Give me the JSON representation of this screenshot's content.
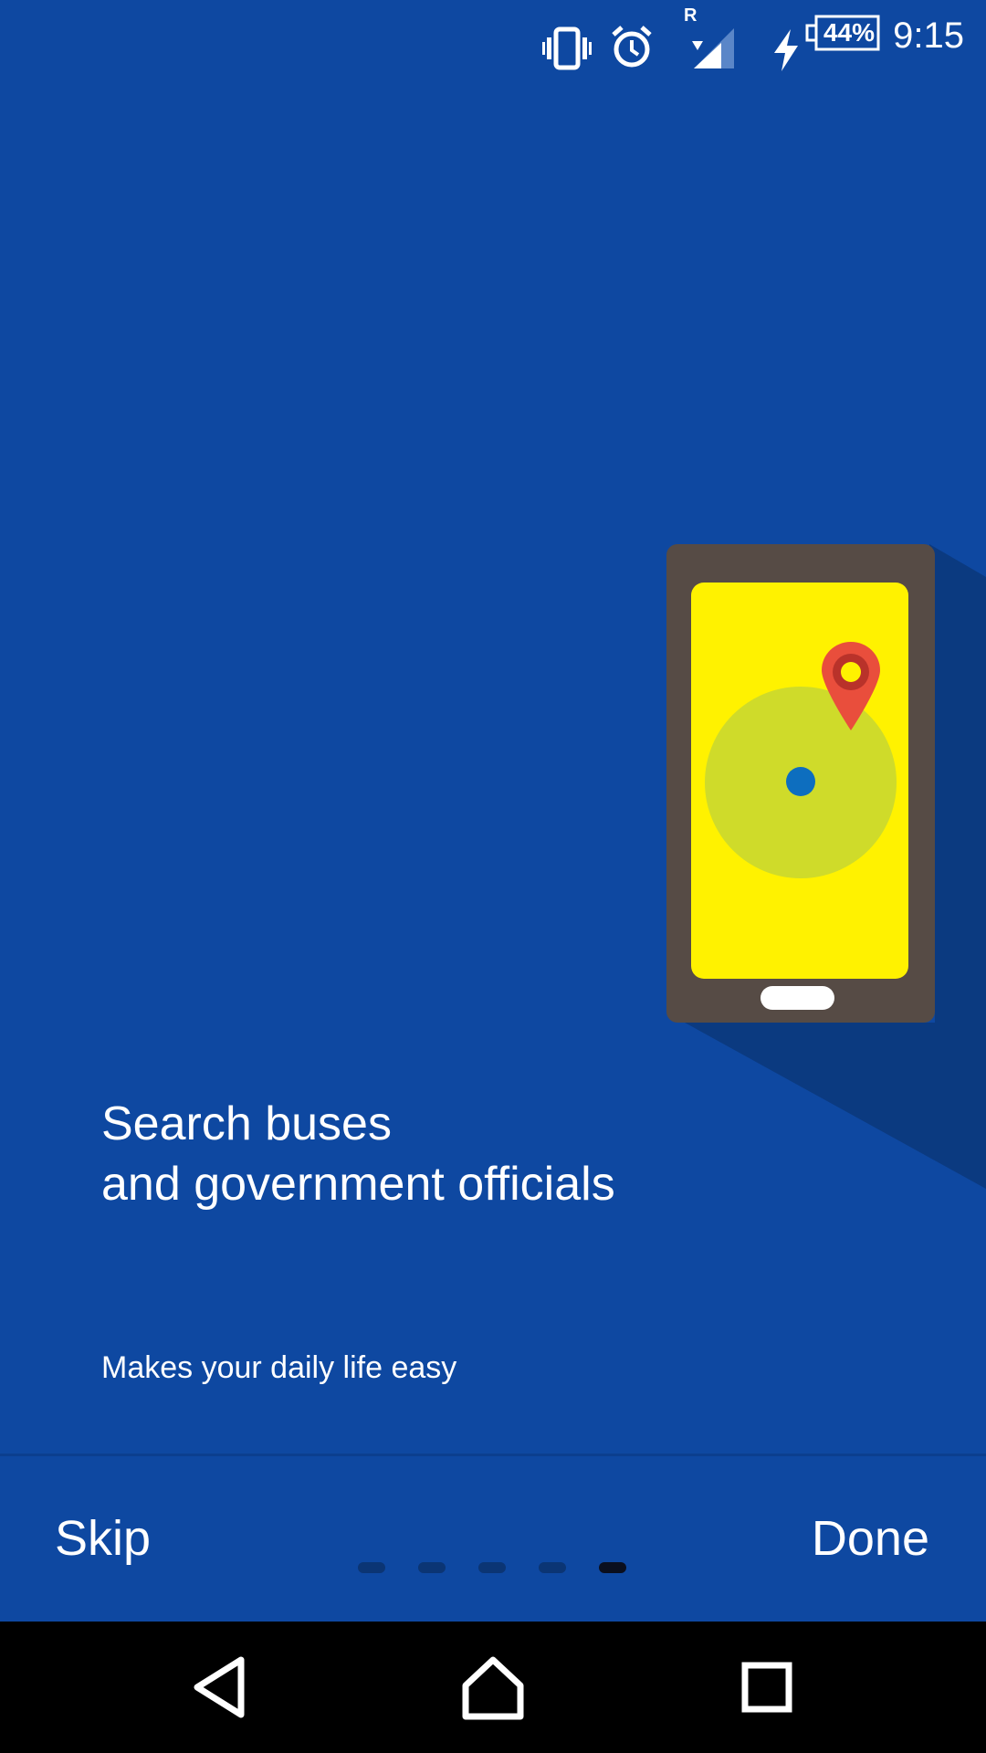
{
  "status_bar": {
    "time": "9:15",
    "battery_percent": "44%",
    "network_indicator": "R",
    "icons": [
      "vibrate-icon",
      "alarm-icon",
      "signal-icon",
      "charging-icon",
      "battery-icon"
    ]
  },
  "onboarding": {
    "title_line1": "Search buses",
    "title_line2": "and government officials",
    "subtitle": "Makes your daily life easy",
    "page_indicator": {
      "total": 5,
      "current": 5
    }
  },
  "bottom_bar": {
    "skip_label": "Skip",
    "done_label": "Done"
  },
  "system_nav": {
    "buttons": [
      "back-icon",
      "home-icon",
      "recents-icon"
    ]
  },
  "colors": {
    "background": "#0e48a1",
    "phone_body": "#564b45",
    "phone_screen": "#fff200",
    "radius_circle": "#cfdb2a",
    "location_dot": "#0d6ebf",
    "pin": "#e94e3c",
    "indicator_inactive": "#0b3574",
    "indicator_active": "#0a0f1e"
  }
}
